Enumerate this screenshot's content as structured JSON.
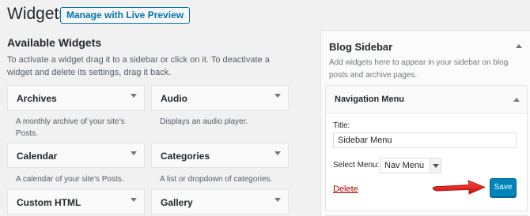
{
  "header": {
    "title": "Widgets",
    "live_preview_label": "Manage with Live Preview"
  },
  "available": {
    "heading": "Available Widgets",
    "description": "To activate a widget drag it to a sidebar or click on it. To deactivate a widget and delete its settings, drag it back.",
    "widgets": [
      {
        "title": "Archives",
        "description": "A monthly archive of your site’s Posts."
      },
      {
        "title": "Audio",
        "description": "Displays an audio player."
      },
      {
        "title": "Calendar",
        "description": "A calendar of your site’s Posts."
      },
      {
        "title": "Categories",
        "description": "A list or dropdown of categories."
      },
      {
        "title": "Custom HTML",
        "description": ""
      },
      {
        "title": "Gallery",
        "description": ""
      }
    ]
  },
  "sidebar": {
    "title": "Blog Sidebar",
    "description": "Add widgets here to appear in your sidebar on blog posts and archive pages.",
    "nav_widget": {
      "title": "Navigation Menu",
      "title_label": "Title:",
      "title_value": "Sidebar Menu",
      "select_label": "Select Menu:",
      "select_value": "Nav Menu",
      "delete_label": "Delete",
      "save_label": "Save"
    }
  },
  "colors": {
    "accent": "#0073aa",
    "primary_button": "#0085ba",
    "delete": "#a00",
    "annotation_arrow": "#e01b1b"
  }
}
